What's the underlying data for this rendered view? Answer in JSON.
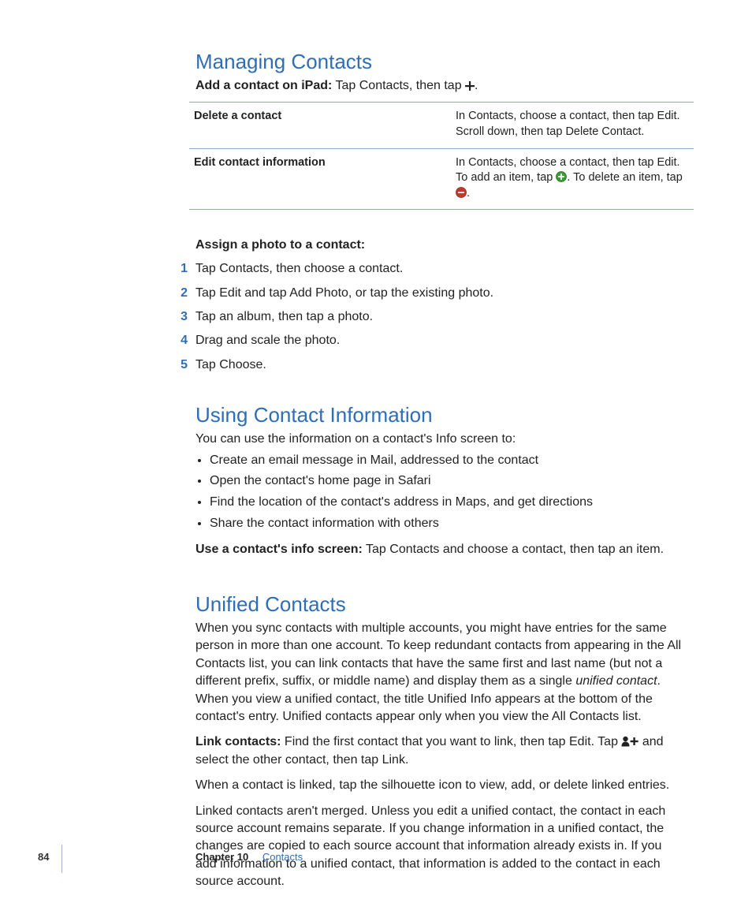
{
  "section1": {
    "heading": "Managing Contacts",
    "lead_bold": "Add a contact on iPad:",
    "lead_rest_a": "  Tap Contacts, then tap ",
    "lead_rest_b": ".",
    "table": {
      "row1_key": "Delete a contact",
      "row1_val": "In Contacts, choose a contact, then tap Edit. Scroll down, then tap Delete Contact.",
      "row2_key": "Edit contact information",
      "row2_val_a": "In Contacts, choose a contact, then tap Edit. To add an item, tap ",
      "row2_val_b": ". To delete an item, tap ",
      "row2_val_c": "."
    },
    "subhead": "Assign a photo to a contact:",
    "steps": [
      "Tap Contacts, then choose a contact.",
      "Tap Edit and tap Add Photo, or tap the existing photo.",
      "Tap an album, then tap a photo.",
      "Drag and scale the photo.",
      "Tap Choose."
    ]
  },
  "section2": {
    "heading": "Using Contact Information",
    "intro": "You can use the information on a contact's Info screen to:",
    "bullets": [
      "Create an email message in Mail, addressed to the contact",
      "Open the contact's home page in Safari",
      "Find the location of the contact's address in Maps, and get directions",
      "Share the contact information with others"
    ],
    "tail_bold": "Use a contact's info screen:",
    "tail_rest": "  Tap Contacts and choose a contact, then tap an item."
  },
  "section3": {
    "heading": "Unified Contacts",
    "p1_a": "When you sync contacts with multiple accounts, you might have entries for the same person in more than one account. To keep redundant contacts from appearing in the All Contacts list, you can link contacts that have the same first and last name (but not a different prefix, suffix, or middle name) and display them as a single ",
    "p1_italic": "unified contact",
    "p1_b": ". When you view a unified contact, the title Unified Info appears at the bottom of the contact's entry. Unified contacts appear only when you view the All Contacts list.",
    "p2_bold": "Link contacts:",
    "p2_a": "  Find the first contact that you want to link, then tap Edit. Tap ",
    "p2_b": " and select the other contact, then tap Link.",
    "p3": "When a contact is linked, tap the silhouette icon to view, add, or delete linked entries.",
    "p4": "Linked contacts aren't merged. Unless you edit a unified contact, the contact in each source account remains separate. If you change information in a unified contact, the changes are copied to each source account that information already exists in. If you add information to a unified contact, that information is added to the contact in each source account."
  },
  "footer": {
    "page": "84",
    "chapter_label": "Chapter 10",
    "chapter_name": "Contacts"
  }
}
